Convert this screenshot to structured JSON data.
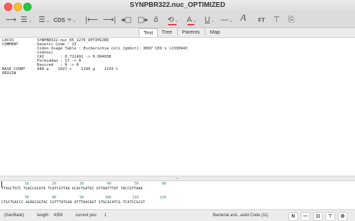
{
  "window": {
    "title": "SYNPBR322.nuc_OPTIMIZED"
  },
  "toolbar": {
    "cds_label": "CDS",
    "ft_label": "FT",
    "font_glyph": "A",
    "colors": {
      "accent": "#e23b3b"
    }
  },
  "tabs": [
    {
      "label": "Text",
      "active": true
    },
    {
      "label": "Tree",
      "active": false
    },
    {
      "label": "Parents",
      "active": false
    },
    {
      "label": "Map",
      "active": false
    }
  ],
  "header": {
    "locus_label": "LOCUS",
    "locus_value": "SYNPBR322.nuc_85_1276_OPTIMIZED",
    "comment_label": "COMMENT",
    "comment_lines": [
      "Genetic Code : 11",
      "Codon Usage Table : Escherichia coli [gbbct]: 8087 CDS's (2330943",
      "codons)",
      "CAI       : 0.711491 -> 0.994938",
      "Forbidden : 17 -> 0",
      "Desired   : 0 -> 0"
    ],
    "base_count_label": "BASE COUNT",
    "base_count_value": "940 a    1027 c    1199 g    1193 t",
    "origin_label": "ORIGIN"
  },
  "sequence": [
    {
      "nums": [
        "10",
        "20",
        "30",
        "40",
        "50",
        "60"
      ],
      "line": "TTAGCTGTC TGACCGCATA TCATCGTTAA GCACTGATGC GTTAATTTAT TACCGTTAAA"
    },
    {
      "nums": [
        "70",
        "80",
        "90",
        "100",
        "110",
        "120"
      ],
      "line": "CTGCTGACCC AGAGCGGTAC CGTTTATGAA ATTTAACAGT GTGCACATCG TCATCCGCGT"
    }
  ],
  "status": {
    "format": "(GenBank)",
    "length_label": "length:",
    "length_value": "4359",
    "pos_label": "current pos:",
    "pos_value": "1",
    "code_label": "Bacterial and...astid Code (11)",
    "btn_n": "N",
    "btn_minus": "—"
  }
}
